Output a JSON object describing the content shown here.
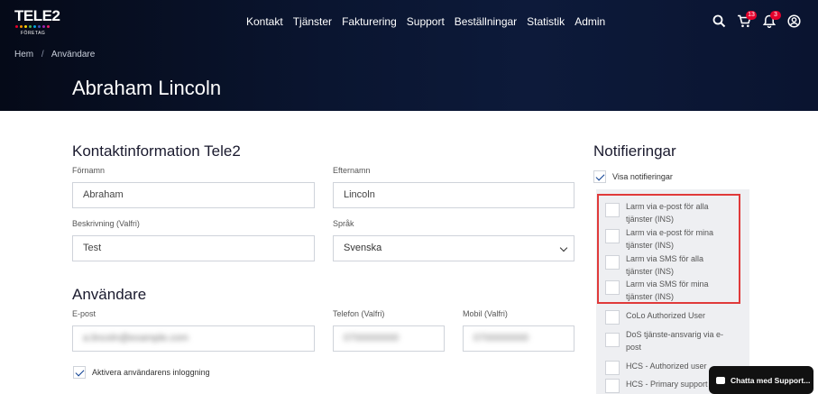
{
  "header": {
    "logo_text": "TELE2",
    "logo_sub": "FÖRETAG",
    "logo_dot_colors": [
      "#e4002b",
      "#f39200",
      "#ffd100",
      "#4caf50",
      "#00a3e0",
      "#3f51b5",
      "#9c27b0",
      "#e91e63"
    ],
    "nav": [
      "Kontakt",
      "Tjänster",
      "Fakturering",
      "Support",
      "Beställningar",
      "Statistik",
      "Admin"
    ],
    "cart_count": "13",
    "notif_count": "3"
  },
  "breadcrumb": {
    "home": "Hem",
    "separator": "/",
    "current": "Användare"
  },
  "page_title": "Abraham Lincoln",
  "contact": {
    "title": "Kontaktinformation Tele2",
    "first_name_label": "Förnamn",
    "first_name": "Abraham",
    "last_name_label": "Efternamn",
    "last_name": "Lincoln",
    "description_label": "Beskrivning (Valfri)",
    "description": "Test",
    "language_label": "Språk",
    "language": "Svenska"
  },
  "user": {
    "title": "Användare",
    "email_label": "E-post",
    "email": "a.lincoln@example.com",
    "phone_label": "Telefon (Valfri)",
    "phone": "0700000000",
    "mobile_label": "Mobil (Valfri)",
    "mobile": "0700000000",
    "activate_label": "Aktivera användarens inloggning"
  },
  "notifications": {
    "title": "Notifieringar",
    "show_label": "Visa notifieringar",
    "items": [
      "Larm via e-post för alla tjänster (INS)",
      "Larm via e-post för mina tjänster (INS)",
      "Larm via SMS för alla tjänster (INS)",
      "Larm via SMS för mina tjänster (INS)",
      "CoLo Authorized User",
      "DoS tjänste-ansvarig via e-post",
      "HCS - Authorized user",
      "HCS - Primary support"
    ]
  },
  "chat": {
    "label": "Chatta med Support..."
  },
  "colors": {
    "accent": "#0a3d91",
    "badge": "#e4002b",
    "highlight": "#e03a3a"
  }
}
